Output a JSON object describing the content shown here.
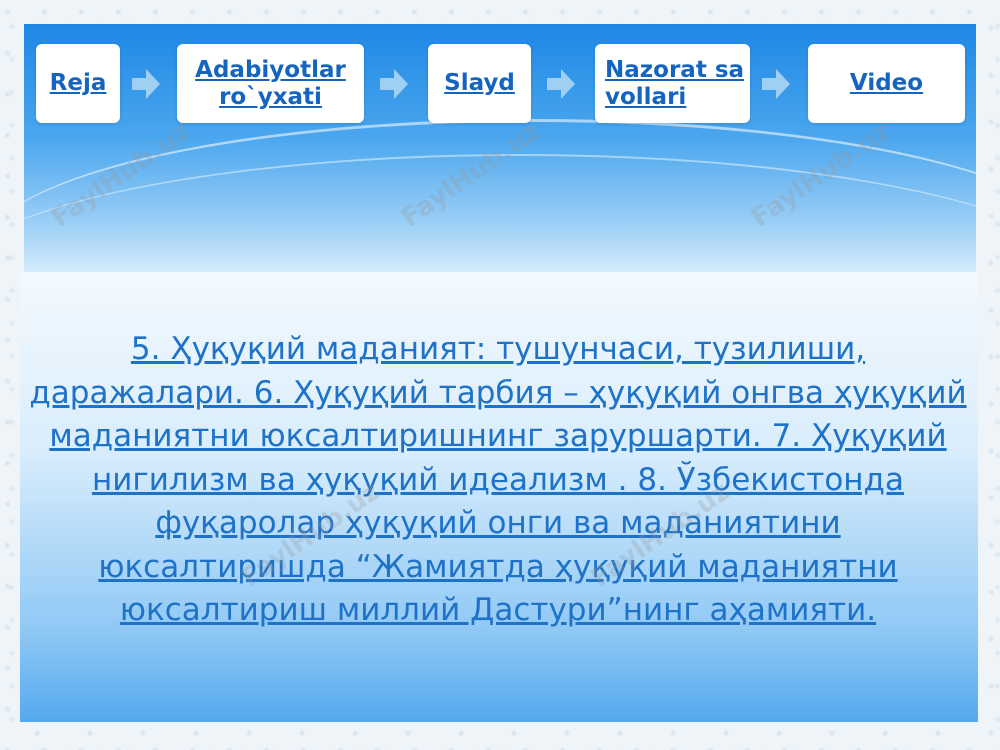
{
  "nav": {
    "items": [
      {
        "label": "Reja"
      },
      {
        "label": "Adabiyotlar ro`yxati"
      },
      {
        "label": "Slayd"
      },
      {
        "label": "Nazorat savollari"
      },
      {
        "label": "Video"
      }
    ]
  },
  "content": {
    "text": "5. Ҳуқуқий маданият: тушунчаси, тузилиши, даражалари. 6. Ҳуқуқий тарбия – ҳуқуқий онгва ҳуқуқий маданиятни юксалтиришнинг заруршарти. 7. Ҳуқуқий нигилизм ва ҳуқуқий идеализм . 8. Ўзбекистонда фуқаролар ҳуқуқий онги ва маданиятини юксалтиришда “Жамиятда ҳуқуқий маданиятни юксалтириш миллий Дастури”нинг аҳамияти."
  },
  "watermark": {
    "text": "FaylHub.uz"
  },
  "colors": {
    "accent": "#1565c0",
    "panel_top": "#1e88e5",
    "text": "#1e72c8"
  }
}
